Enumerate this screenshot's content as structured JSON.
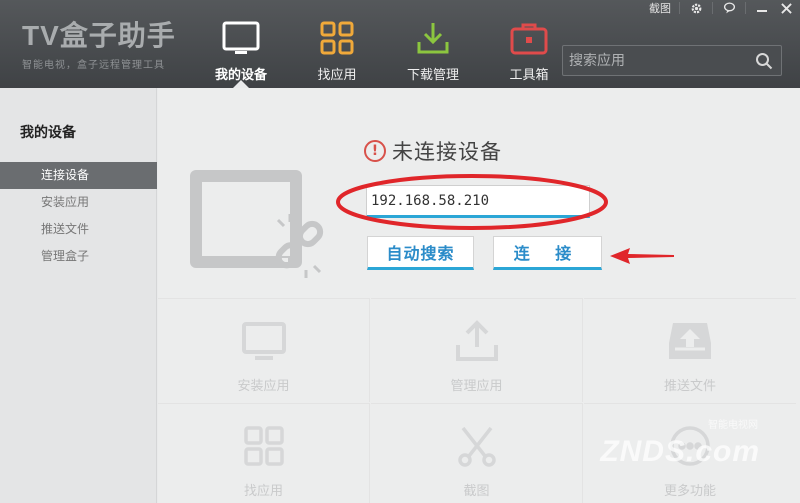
{
  "app": {
    "logo_title": "TV盒子助手",
    "logo_subtitle": "智能电视，盒子远程管理工具"
  },
  "topbar": {
    "screenshot_label": "截图",
    "icons": [
      "gear-icon",
      "chat-icon",
      "minimize-icon",
      "close-icon"
    ]
  },
  "nav": {
    "items": [
      {
        "label": "我的设备",
        "icon": "monitor-icon",
        "active": true
      },
      {
        "label": "找应用",
        "icon": "grid-icon",
        "active": false
      },
      {
        "label": "下载管理",
        "icon": "download-icon",
        "active": false
      },
      {
        "label": "工具箱",
        "icon": "toolbox-icon",
        "active": false
      }
    ]
  },
  "search": {
    "placeholder": "搜索应用"
  },
  "sidebar": {
    "title": "我的设备",
    "items": [
      {
        "label": "连接设备",
        "active": true
      },
      {
        "label": "安装应用",
        "active": false
      },
      {
        "label": "推送文件",
        "active": false
      },
      {
        "label": "管理盒子",
        "active": false
      }
    ]
  },
  "main": {
    "status_text": "未连接设备",
    "ip_value": "192.168.58.210",
    "auto_search_label": "自动搜索",
    "connect_label": "连 接"
  },
  "features": [
    {
      "label": "安装应用",
      "icon": "monitor-icon"
    },
    {
      "label": "管理应用",
      "icon": "upload-icon"
    },
    {
      "label": "推送文件",
      "icon": "inbox-upload-icon"
    },
    {
      "label": "找应用",
      "icon": "grid-icon"
    },
    {
      "label": "截图",
      "icon": "scissors-icon"
    },
    {
      "label": "更多功能",
      "icon": "more-icon"
    }
  ],
  "watermark": {
    "text": "ZNDS.com",
    "sub": "智能电视网"
  },
  "colors": {
    "header_bg": "#484b4e",
    "accent_blue": "#2ba6d6",
    "annotation_red": "#e0262a",
    "sidebar_active": "#6a6d70"
  }
}
